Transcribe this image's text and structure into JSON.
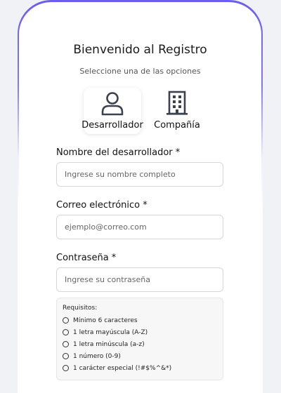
{
  "header": {
    "title": "Bienvenido al Registro",
    "subtitle": "Seleccione una de las opciones"
  },
  "options": [
    {
      "label": "Desarrollador",
      "icon": "user-icon",
      "selected": true
    },
    {
      "label": "Compañía",
      "icon": "building-icon",
      "selected": false
    }
  ],
  "form": {
    "name_label": "Nombre del desarrollador *",
    "name_placeholder": "Ingrese su nombre completo",
    "email_label": "Correo electrónico *",
    "email_placeholder": "ejemplo@correo.com",
    "password_label": "Contraseña *",
    "password_placeholder": "Ingrese su contraseña"
  },
  "requirements": {
    "title": "Requisitos:",
    "items": [
      "Mínimo 6 caracteres",
      "1 letra mayúscula (A-Z)",
      "1 letra minúscula (a-z)",
      "1 número (0-9)",
      "1 carácter especial (!#$%^&*)"
    ]
  },
  "colors": {
    "accent": "#6a5df0",
    "icon": "#3b4150"
  }
}
